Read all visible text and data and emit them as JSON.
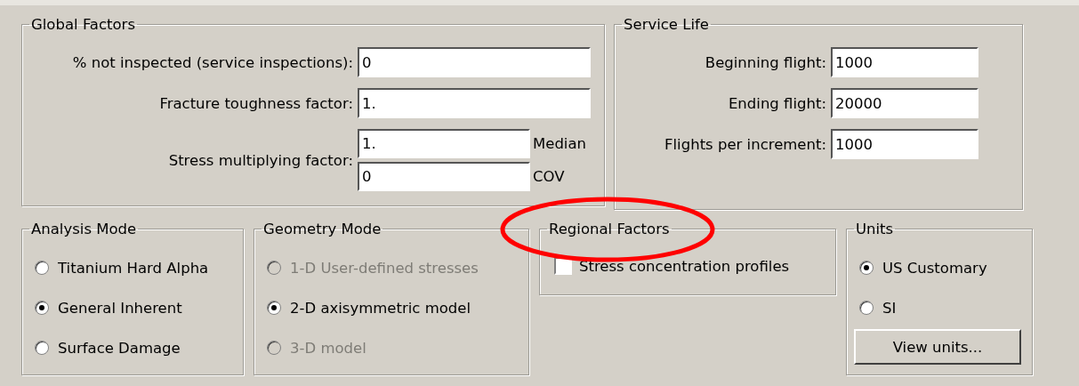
{
  "global_factors": {
    "title": "Global Factors",
    "fields": [
      {
        "label": "% not inspected (service inspections):",
        "value": "0"
      },
      {
        "label": "Fracture toughness factor:",
        "value": "1."
      }
    ],
    "stress": {
      "label": "Stress multiplying factor:",
      "fields": [
        {
          "value": "1.",
          "unit": "Median"
        },
        {
          "value": "0",
          "unit": "COV"
        }
      ]
    }
  },
  "service_life": {
    "title": "Service Life",
    "fields": [
      {
        "label": "Beginning flight:",
        "value": "1000"
      },
      {
        "label": "Ending flight:",
        "value": "20000"
      },
      {
        "label": "Flights per increment:",
        "value": "1000"
      }
    ]
  },
  "analysis_mode": {
    "title": "Analysis Mode",
    "options": [
      {
        "label": "Titanium Hard Alpha",
        "selected": false,
        "disabled": false
      },
      {
        "label": "General Inherent",
        "selected": true,
        "disabled": false
      },
      {
        "label": "Surface Damage",
        "selected": false,
        "disabled": false
      }
    ]
  },
  "geometry_mode": {
    "title": "Geometry Mode",
    "options": [
      {
        "label": "1-D User-defined stresses",
        "selected": false,
        "disabled": true
      },
      {
        "label": "2-D axisymmetric model",
        "selected": true,
        "disabled": false
      },
      {
        "label": "3-D model",
        "selected": false,
        "disabled": true
      }
    ]
  },
  "regional_factors": {
    "title": "Regional Factors",
    "checkbox": {
      "label": "Stress concentration profiles",
      "checked": false
    }
  },
  "units": {
    "title": "Units",
    "options": [
      {
        "label": "US Customary",
        "selected": true,
        "disabled": false
      },
      {
        "label": "SI",
        "selected": false,
        "disabled": false
      }
    ],
    "button": "View units..."
  }
}
